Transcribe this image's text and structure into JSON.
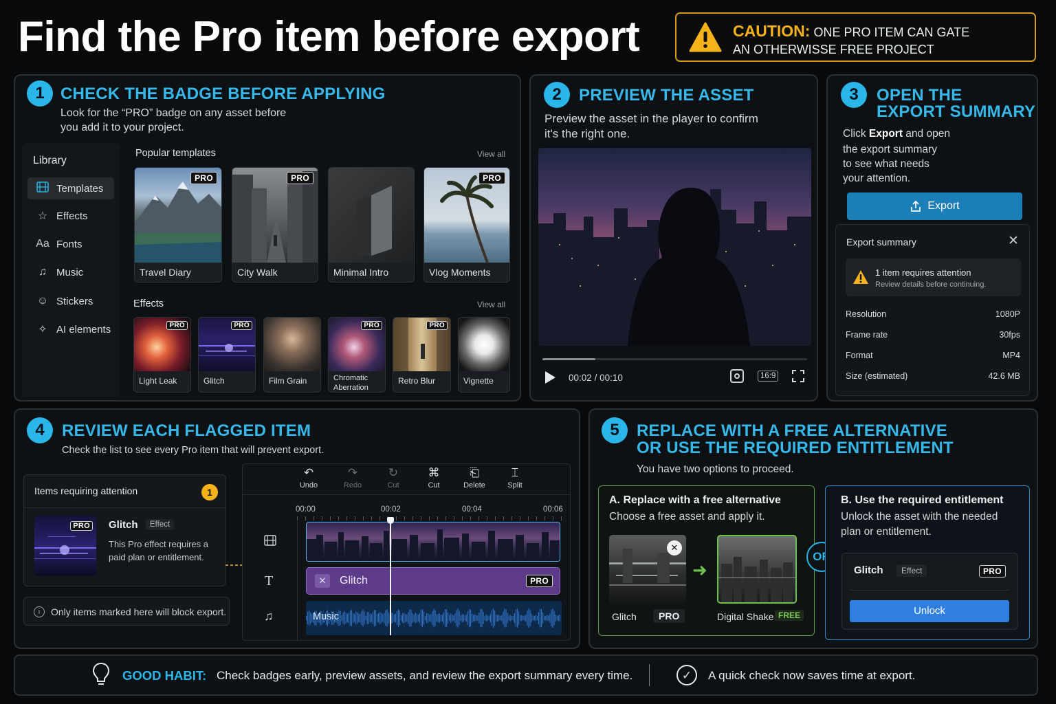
{
  "title": "Find the Pro item before export",
  "caution": {
    "label": "CAUTION:",
    "line1": "ONE PRO ITEM CAN GATE",
    "line2": "AN OTHERWISSE FREE PROJECT"
  },
  "step1": {
    "num": "1",
    "title": "CHECK THE BADGE BEFORE APPLYING",
    "desc1": "Look for the “PRO” badge on any asset before",
    "desc2": "you add it to your project.",
    "sidebar": {
      "heading": "Library",
      "items": [
        {
          "label": "Templates",
          "icon": "film-icon"
        },
        {
          "label": "Effects",
          "icon": "star-icon"
        },
        {
          "label": "Fonts",
          "icon": "font-icon"
        },
        {
          "label": "Music",
          "icon": "music-icon"
        },
        {
          "label": "Stickers",
          "icon": "smiley-icon"
        },
        {
          "label": "AI elements",
          "icon": "sparkle-icon"
        }
      ]
    },
    "templates": {
      "heading": "Popular templates",
      "view_all": "View all",
      "items": [
        {
          "label": "Travel Diary",
          "badge": "PRO"
        },
        {
          "label": "City Walk",
          "badge": "PRO"
        },
        {
          "label": "Minimal Intro",
          "badge": ""
        },
        {
          "label": "Vlog Moments",
          "badge": "PRO"
        }
      ]
    },
    "effects": {
      "heading": "Effects",
      "view_all": "View all",
      "items": [
        {
          "label": "Light Leak",
          "badge": "PRO"
        },
        {
          "label": "Glitch",
          "badge": "PRO"
        },
        {
          "label": "Film Grain",
          "badge": ""
        },
        {
          "label": "Chromatic",
          "label2": "Aberration",
          "badge": "PRO"
        },
        {
          "label": "Retro Blur",
          "badge": "PRO"
        },
        {
          "label": "Vignette",
          "badge": ""
        }
      ]
    }
  },
  "step2": {
    "num": "2",
    "title": "PREVIEW THE ASSET",
    "desc1": "Preview the asset in the player to confirm",
    "desc2": "it's the right one.",
    "player": {
      "current": "00:02",
      "sep": "/",
      "total": "00:10",
      "ratio": "16:9",
      "progress": 0.2
    }
  },
  "step3": {
    "num": "3",
    "title1": "OPEN THE",
    "title2": "EXPORT SUMMARY",
    "desc_pre": "Click ",
    "desc_bold": "Export",
    "desc_post": " and open",
    "desc2": "the export summary",
    "desc3": "to see what needs",
    "desc4": "your attention.",
    "export_button": "Export",
    "summary": {
      "heading": "Export summary",
      "alert_title": "1 item requires attention",
      "alert_sub": "Review details before continuing.",
      "rows": [
        {
          "key": "Resolution",
          "value": "1080P"
        },
        {
          "key": "Frame rate",
          "value": "30fps"
        },
        {
          "key": "Format",
          "value": "MP4"
        },
        {
          "key": "Size (estimated)",
          "value": "42.6 MB"
        }
      ]
    }
  },
  "step4": {
    "num": "4",
    "title": "REVIEW EACH FLAGGED ITEM",
    "desc": "Check the list to see every Pro item that will prevent export.",
    "attention": {
      "heading": "Items requiring attention",
      "count": "1",
      "item": {
        "name": "Glitch",
        "tag": "Effect",
        "badge": "PRO",
        "desc1": "This Pro effect requires a",
        "desc2": "paid plan or entitlement."
      },
      "note": "Only items marked here will block export."
    },
    "toolbar": [
      {
        "label": "Undo",
        "glyph": "↶",
        "enabled": true
      },
      {
        "label": "Redo",
        "glyph": "↷",
        "enabled": false
      },
      {
        "label": "Cut",
        "glyph": "↻",
        "enabled": false
      },
      {
        "label": "Cut",
        "glyph": "⌘",
        "enabled": true
      },
      {
        "label": "Delete",
        "glyph": "⎗",
        "enabled": true
      },
      {
        "label": "Split",
        "glyph": "⌶",
        "enabled": true
      }
    ],
    "ticks": [
      "00:00",
      "00:02",
      "00:04",
      "00:06"
    ],
    "tracks": {
      "effect_label": "Glitch",
      "effect_badge": "PRO",
      "music_label": "Music"
    },
    "playhead": 0.33
  },
  "step5": {
    "num": "5",
    "title1": "REPLACE WITH A FREE ALTERNATIVE",
    "title2": "OR USE THE REQUIRED ENTITLEMENT",
    "desc": "You have two options to proceed.",
    "optionA": {
      "title": "A. Replace with a free alternative",
      "desc": "Choose a free asset and apply it.",
      "from_label": "Glitch",
      "from_badge": "PRO",
      "to_label": "Digital Shake",
      "to_badge": "FREE"
    },
    "or": "OR",
    "optionB": {
      "title": "B. Use the required entitlement",
      "desc1": "Unlock the asset with the needed",
      "desc2": "plan or entitlement.",
      "item_name": "Glitch",
      "item_tag": "Effect",
      "item_badge": "PRO",
      "unlock": "Unlock"
    }
  },
  "footer": {
    "label": "GOOD HABIT:",
    "text": "Check badges early, preview assets, and review the export summary every time.",
    "text2": "A quick check now saves time at export."
  },
  "colors": {
    "accent": "#2ab6e8",
    "caution": "#f5b21b",
    "free": "#7dc95a",
    "effect_track": "#5d3b8a",
    "unlock": "#2f7fe0"
  }
}
